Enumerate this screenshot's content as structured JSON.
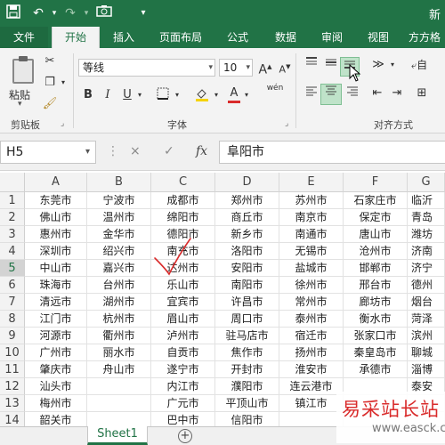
{
  "colors": {
    "brand": "#217346",
    "mark": "#d92b2b"
  },
  "qat": {
    "title_partial": "新",
    "icons": [
      "save-icon",
      "undo-icon",
      "redo-icon",
      "camera-icon",
      "customize-icon"
    ]
  },
  "tabs": [
    "文件",
    "开始",
    "插入",
    "页面布局",
    "公式",
    "数据",
    "审阅",
    "视图",
    "方方格"
  ],
  "ribbon": {
    "paste_label": "粘贴",
    "clipboard_label": "剪贴板",
    "font_name": "等线",
    "font_size": "10",
    "grow_font": "A",
    "shrink_font": "A",
    "bold": "B",
    "italic": "I",
    "underline": "U",
    "font_color_letter": "A",
    "phonetic": "wén",
    "font_label": "字体",
    "align_label": "对齐方式",
    "auto_wrap_partial": "自"
  },
  "formula_bar": {
    "cell_ref": "H5",
    "cancel": "×",
    "enter": "✓",
    "fx": "fx",
    "value": "阜阳市"
  },
  "columns": [
    "A",
    "B",
    "C",
    "D",
    "E",
    "F",
    "G"
  ],
  "rows": [
    "1",
    "2",
    "3",
    "4",
    "5",
    "6",
    "7",
    "8",
    "9",
    "10",
    "11",
    "12",
    "13",
    "14"
  ],
  "cells": [
    [
      "东莞市",
      "宁波市",
      "成都市",
      "郑州市",
      "苏州市",
      "石家庄市",
      "临沂"
    ],
    [
      "佛山市",
      "温州市",
      "绵阳市",
      "商丘市",
      "南京市",
      "保定市",
      "青岛"
    ],
    [
      "惠州市",
      "金华市",
      "德阳市",
      "新乡市",
      "南通市",
      "唐山市",
      "潍坊"
    ],
    [
      "深圳市",
      "绍兴市",
      "南充市",
      "洛阳市",
      "无锡市",
      "沧州市",
      "济南"
    ],
    [
      "中山市",
      "嘉兴市",
      "达州市",
      "安阳市",
      "盐城市",
      "邯郸市",
      "济宁"
    ],
    [
      "珠海市",
      "台州市",
      "乐山市",
      "南阳市",
      "徐州市",
      "邢台市",
      "德州"
    ],
    [
      "清远市",
      "湖州市",
      "宜宾市",
      "许昌市",
      "常州市",
      "廊坊市",
      "烟台"
    ],
    [
      "江门市",
      "杭州市",
      "眉山市",
      "周口市",
      "泰州市",
      "衡水市",
      "菏泽"
    ],
    [
      "河源市",
      "衢州市",
      "泸州市",
      "驻马店市",
      "宿迁市",
      "张家口市",
      "滨州"
    ],
    [
      "广州市",
      "丽水市",
      "自贡市",
      "焦作市",
      "扬州市",
      "秦皇岛市",
      "聊城"
    ],
    [
      "肇庆市",
      "舟山市",
      "遂宁市",
      "开封市",
      "淮安市",
      "承德市",
      "淄博"
    ],
    [
      "汕头市",
      "",
      "内江市",
      "濮阳市",
      "连云港市",
      "",
      "泰安"
    ],
    [
      "梅州市",
      "",
      "广元市",
      "平顶山市",
      "镇江市",
      "",
      ""
    ],
    [
      "韶关市",
      "",
      "巴中市",
      "信阳市",
      "",
      "",
      ""
    ]
  ],
  "sheet_tab": "Sheet1",
  "add_sheet": "+",
  "watermark": {
    "text": "易采站长站",
    "url": "www.easck.com"
  }
}
